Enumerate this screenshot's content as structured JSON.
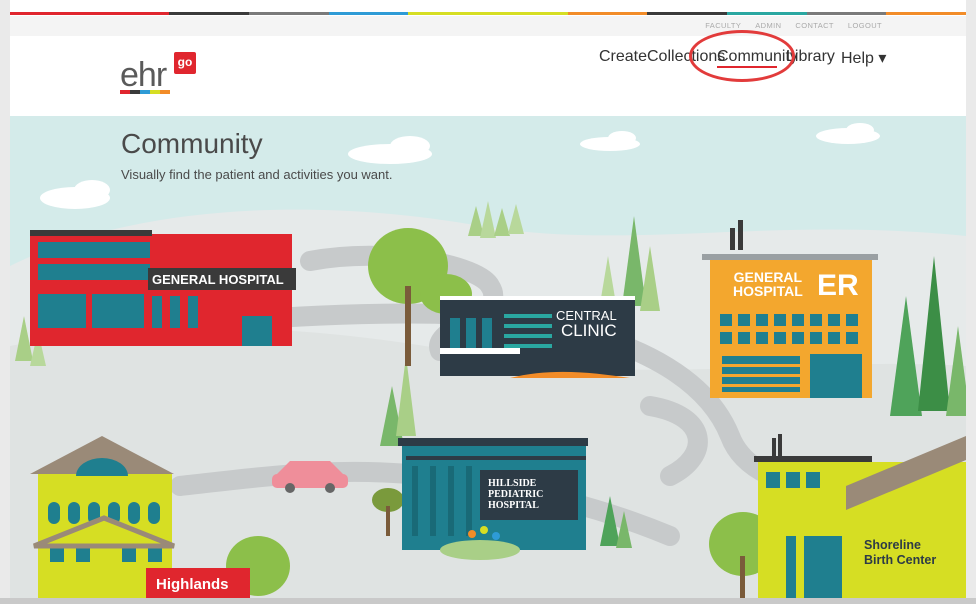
{
  "accent_colors": [
    "#e0262e",
    "#3a3a3a",
    "#7a7a7a",
    "#2e9bd6",
    "#d6de23",
    "#f28c28",
    "#2aa7a1"
  ],
  "utility_links": [
    "FACULTY",
    "ADMIN",
    "CONTACT",
    "LOGOUT"
  ],
  "logo": {
    "text": "ehr",
    "badge": "go"
  },
  "nav": {
    "create": "Create",
    "collections": "Collections",
    "community": "Community",
    "library": "Library",
    "help": "Help ▾",
    "active": "Community"
  },
  "page": {
    "title": "Community",
    "subtitle": "Visually find the patient and activities you want."
  },
  "buildings": {
    "general_hospital": "GENERAL HOSPITAL",
    "central_clinic_line1": "CENTRAL",
    "central_clinic_line2": "CLINIC",
    "general_er_line1": "GENERAL",
    "general_er_line2": "HOSPITAL",
    "general_er_badge": "ER",
    "hillside_line1": "HILLSIDE",
    "hillside_line2": "PEDIATRIC",
    "hillside_line3": "HOSPITAL",
    "shoreline_line1": "Shoreline",
    "shoreline_line2": "Birth Center",
    "highlands": "Highlands"
  }
}
